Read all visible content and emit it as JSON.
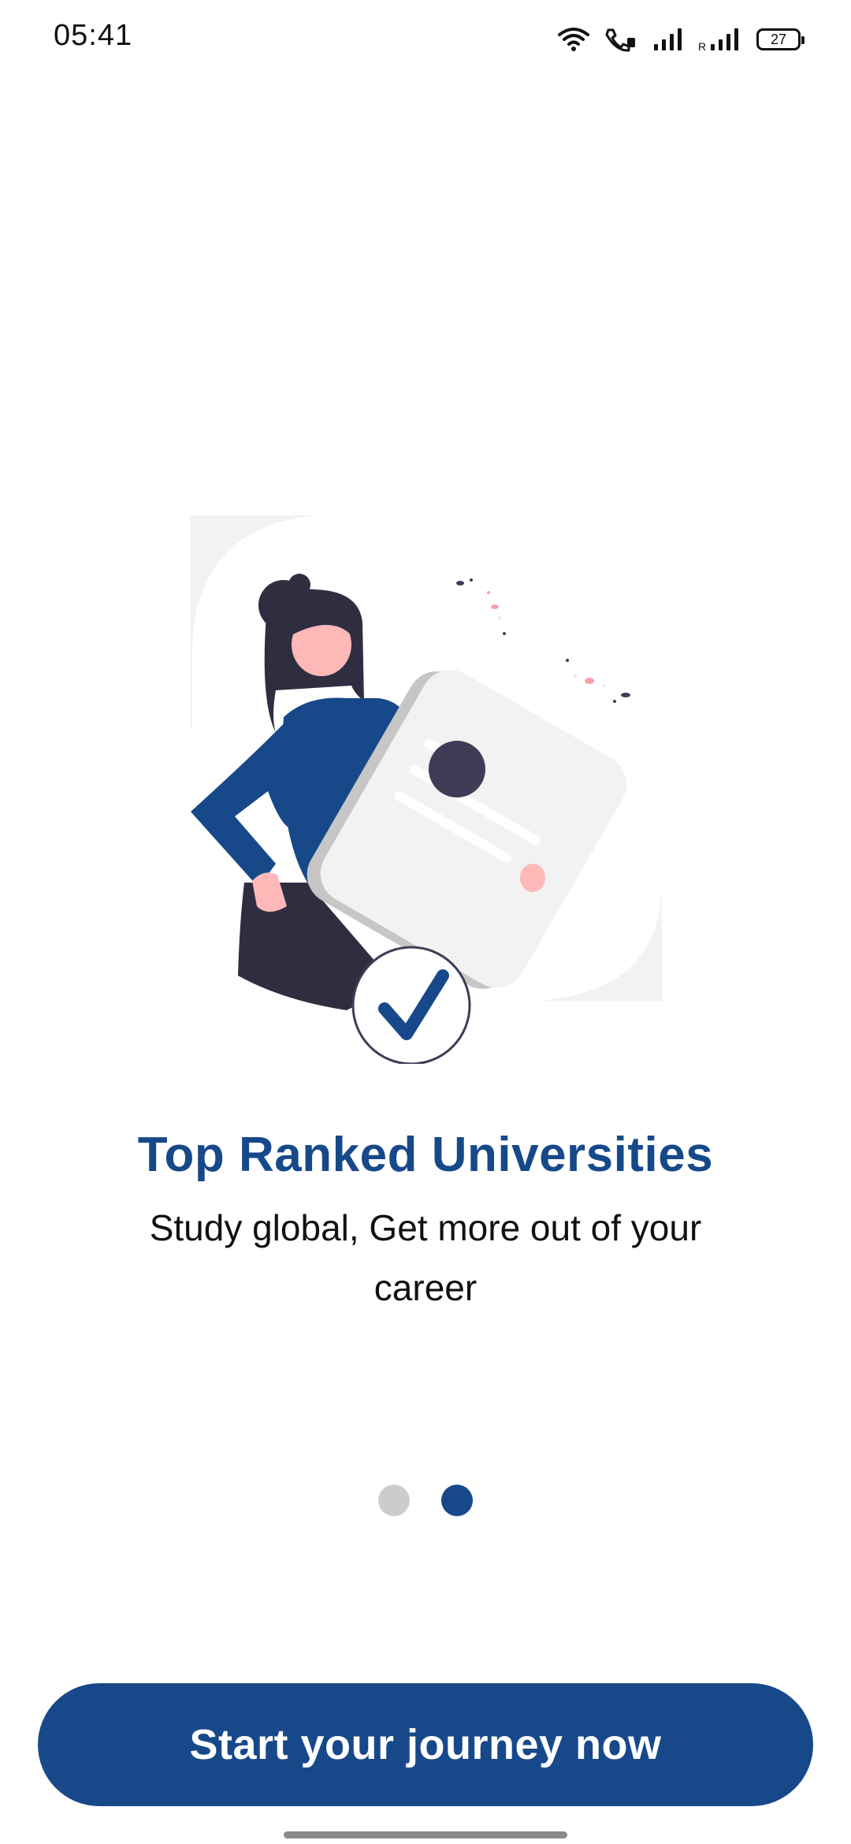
{
  "status_bar": {
    "time": "05:41",
    "battery": "27",
    "icons": [
      "wifi-icon",
      "wifi-calling-icon",
      "signal-icon",
      "roaming-signal-icon",
      "battery-icon"
    ],
    "roaming_label": "R"
  },
  "onboarding": {
    "title": "Top Ranked Universities",
    "subtitle": "Study global, Get more out of your career",
    "illustration": "woman-holding-checked-document-illustration",
    "page_indicator": {
      "current": 2,
      "total": 2
    }
  },
  "cta": {
    "label": "Start your journey now"
  },
  "colors": {
    "primary": "#17498a",
    "dot_inactive": "#cccccc",
    "text": "#111111",
    "background": "#ffffff"
  }
}
